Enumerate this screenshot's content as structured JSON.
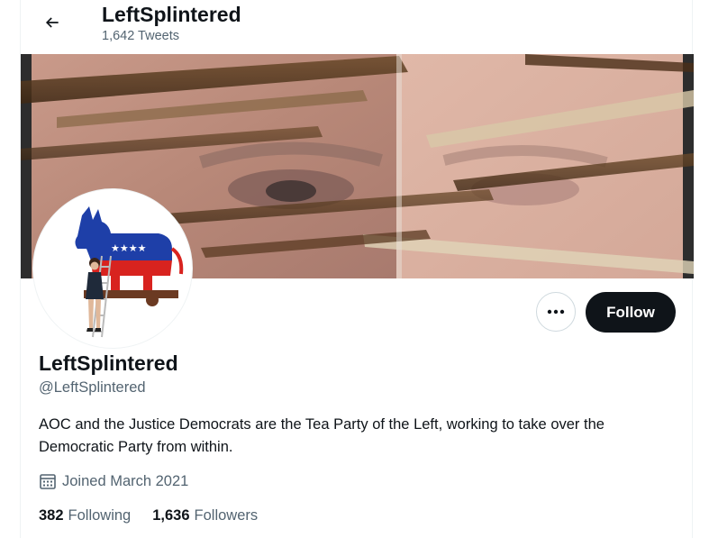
{
  "header": {
    "title": "LeftSplintered",
    "tweet_count": "1,642 Tweets"
  },
  "banner": {
    "description_icon": "banner-image"
  },
  "avatar": {
    "icon": "donkey-logo-avatar"
  },
  "actions": {
    "follow_label": "Follow",
    "more_icon": "ellipsis-icon"
  },
  "profile": {
    "display_name": "LeftSplintered",
    "handle": "@LeftSplintered",
    "bio": "AOC and the Justice Democrats are the Tea Party of the Left, working to take over the Democratic Party from within.",
    "joined": "Joined March 2021"
  },
  "stats": {
    "following_count": "382",
    "following_label": "Following",
    "followers_count": "1,636",
    "followers_label": "Followers"
  },
  "colors": {
    "text_primary": "#0f1419",
    "text_secondary": "#536471",
    "follow_bg": "#0f1419",
    "border": "#cfd9de"
  }
}
